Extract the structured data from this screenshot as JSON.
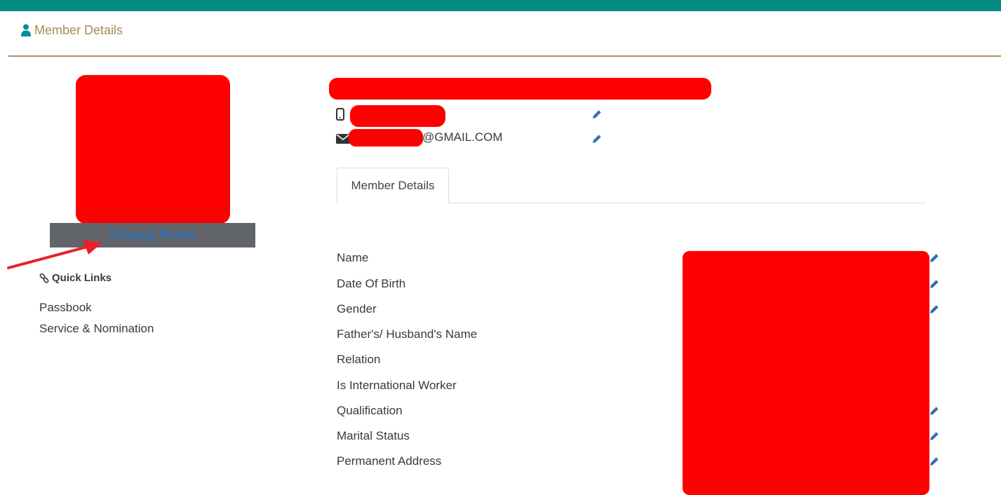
{
  "header": {
    "title": "Member Details"
  },
  "profile": {
    "change_photo_label": "Change Photo"
  },
  "quick_links": {
    "title": "Quick Links",
    "items": [
      "Passbook",
      "Service & Nomination"
    ]
  },
  "contact": {
    "email_suffix": "@GMAIL.COM"
  },
  "tabs": [
    {
      "label": "Member Details"
    }
  ],
  "fields": [
    {
      "label": "Name",
      "editable": true
    },
    {
      "label": "Date Of Birth",
      "editable": true
    },
    {
      "label": "Gender",
      "editable": true
    },
    {
      "label": "Father's/ Husband's Name",
      "editable": false
    },
    {
      "label": "Relation",
      "editable": false
    },
    {
      "label": "Is International Worker",
      "editable": false
    },
    {
      "label": "Qualification",
      "editable": true
    },
    {
      "label": "Marital Status",
      "editable": true
    },
    {
      "label": "Permanent Address",
      "editable": true
    }
  ],
  "colors": {
    "topbar": "#058983",
    "heading": "#a88a5a",
    "link_blue": "#2f6fb7",
    "redaction": "#ff0000"
  }
}
